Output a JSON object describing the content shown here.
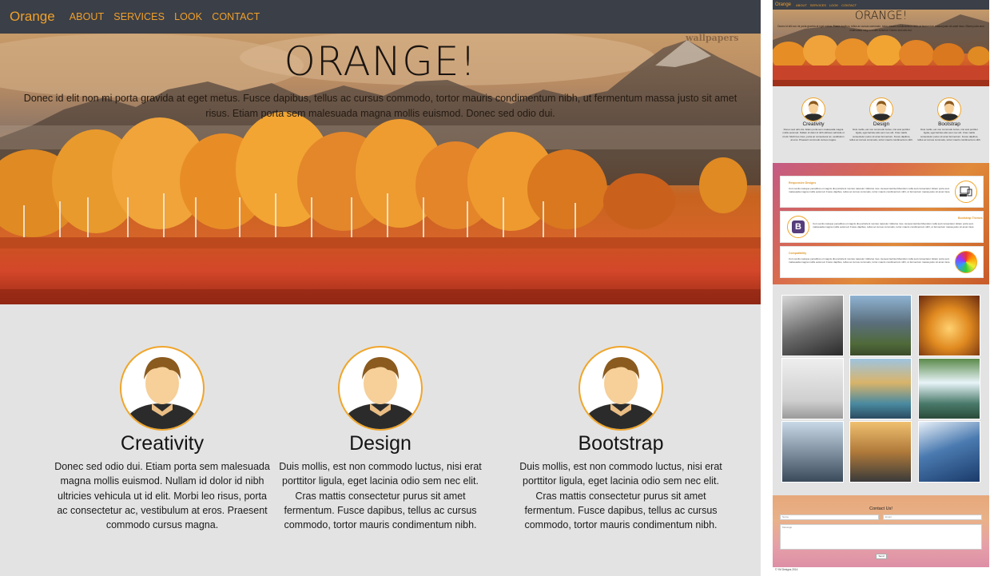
{
  "nav": {
    "brand": "Orange",
    "links": [
      "ABOUT",
      "SERVICES",
      "LOOK",
      "CONTACT"
    ]
  },
  "hero": {
    "title": "ORANGE!",
    "text": "Donec id elit non mi porta gravida at eget metus. Fusce dapibus, tellus ac cursus commodo, tortor mauris condimentum nibh, ut fermentum massa justo sit amet risus. Etiam porta sem malesuada magna mollis euismod. Donec sed odio dui.",
    "watermark": "wallpapers"
  },
  "features": [
    {
      "title": "Creativity",
      "text": "Donec sed odio dui. Etiam porta sem malesuada magna mollis euismod. Nullam id dolor id nibh ultricies vehicula ut id elit. Morbi leo risus, porta ac consectetur ac, vestibulum at eros. Praesent commodo cursus magna."
    },
    {
      "title": "Design",
      "text": "Duis mollis, est non commodo luctus, nisi erat porttitor ligula, eget lacinia odio sem nec elit. Cras mattis consectetur purus sit amet fermentum. Fusce dapibus, tellus ac cursus commodo, tortor mauris condimentum nibh."
    },
    {
      "title": "Bootstrap",
      "text": "Duis mollis, est non commodo luctus, nisi erat porttitor ligula, eget lacinia odio sem nec elit. Cras mattis consectetur purus sit amet fermentum. Fusce dapibus, tellus ac cursus commodo, tortor mauris condimentum nibh."
    }
  ],
  "thumbnail": {
    "cards": [
      {
        "title": "Responsive Designs",
        "text": "Cum sociis natoque penatibus et magnis dis parturient montes nascetur ridiculus mus. Aenean lacinia bibendum nulla sed consectetur. Etiam porta sem malesuada magna mollis euismod. Fusce dapibus, tellus ac cursus commodo, tortor mauris condimentum nibh, ut fermentum massa justo sit amet risus."
      },
      {
        "title": "Bootstrap Themes",
        "text": "Cum sociis natoque penatibus et magnis dis parturient montes nascetur ridiculus mus. Aenean lacinia bibendum nulla sed consectetur. Etiam porta sem malesuada magna mollis euismod. Fusce dapibus, tellus ac cursus commodo, tortor mauris condimentum nibh, ut fermentum massa justo sit amet risus."
      },
      {
        "title": "Compatibility",
        "text": "Cum sociis natoque penatibus et magnis dis parturient montes nascetur ridiculus mus. Aenean lacinia bibendum nulla sed consectetur. Etiam porta sem malesuada magna mollis euismod. Fusce dapibus, tellus ac cursus commodo, tortor mauris condimentum nibh, ut fermentum massa justo sit amet risus."
      }
    ],
    "bootstrap_letter": "B",
    "contact": {
      "title": "Contact Us!",
      "name_placeholder": "Name",
      "email_placeholder": "Email",
      "message_placeholder": "Message",
      "send_label": "Send"
    },
    "footer": "© YM Designs 2014"
  },
  "colors": {
    "accent": "#f0a02a",
    "navbar": "#3b3f47",
    "section_bg": "#e3e3e3"
  }
}
